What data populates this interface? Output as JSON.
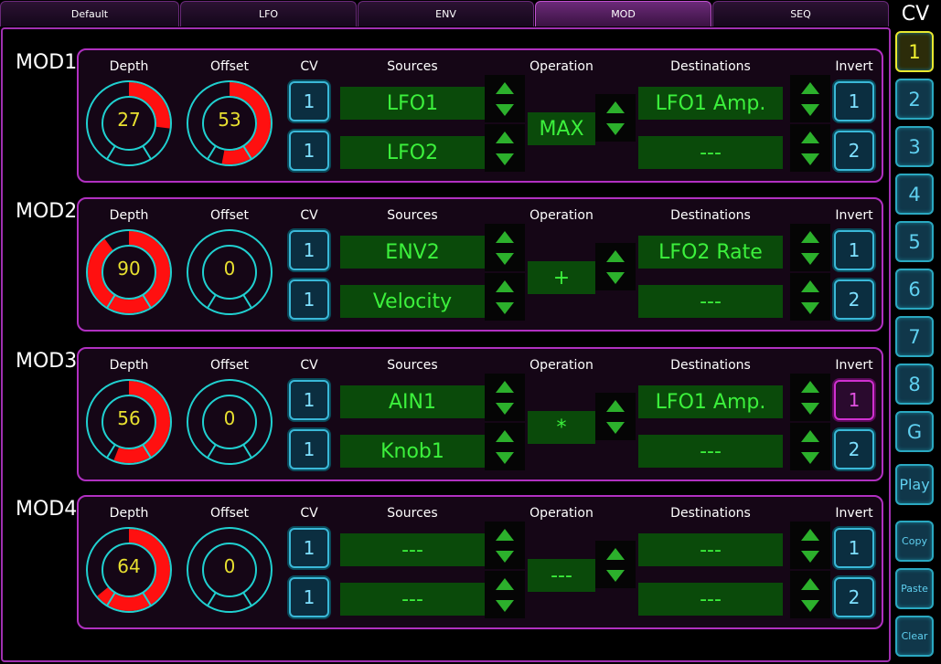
{
  "tabs": [
    {
      "label": "Default"
    },
    {
      "label": "LFO"
    },
    {
      "label": "ENV"
    },
    {
      "label": "MOD"
    },
    {
      "label": "SEQ"
    }
  ],
  "sidebar": {
    "title": "CV",
    "buttons": [
      "1",
      "2",
      "3",
      "4",
      "5",
      "6",
      "7",
      "8",
      "G",
      "Play",
      "Copy",
      "Paste",
      "Clear"
    ]
  },
  "headers": {
    "depth": "Depth",
    "offset": "Offset",
    "cv": "CV",
    "sources": "Sources",
    "operation": "Operation",
    "destinations": "Destinations",
    "invert": "Invert"
  },
  "mods": [
    {
      "label": "MOD1",
      "depth": "27",
      "offset": "53",
      "cv": [
        "1",
        "1"
      ],
      "sources": [
        "LFO1",
        "LFO2"
      ],
      "operation": "MAX",
      "destinations": [
        "LFO1 Amp.",
        "---"
      ],
      "invert": [
        "1",
        "2"
      ],
      "invert_on": [
        false,
        false
      ]
    },
    {
      "label": "MOD2",
      "depth": "90",
      "offset": "0",
      "cv": [
        "1",
        "1"
      ],
      "sources": [
        "ENV2",
        "Velocity"
      ],
      "operation": "+",
      "destinations": [
        "LFO2 Rate",
        "---"
      ],
      "invert": [
        "1",
        "2"
      ],
      "invert_on": [
        false,
        false
      ]
    },
    {
      "label": "MOD3",
      "depth": "56",
      "offset": "0",
      "cv": [
        "1",
        "1"
      ],
      "sources": [
        "AIN1",
        "Knob1"
      ],
      "operation": "*",
      "destinations": [
        "LFO1 Amp.",
        "---"
      ],
      "invert": [
        "1",
        "2"
      ],
      "invert_on": [
        true,
        false
      ]
    },
    {
      "label": "MOD4",
      "depth": "64",
      "offset": "0",
      "cv": [
        "1",
        "1"
      ],
      "sources": [
        "---",
        "---"
      ],
      "operation": "---",
      "destinations": [
        "---",
        "---"
      ],
      "invert": [
        "1",
        "2"
      ],
      "invert_on": [
        false,
        false
      ]
    }
  ],
  "colors": {
    "accent_purple": "#b030c0",
    "knob_ring": "#20d0d0",
    "knob_fill": "#ff1010",
    "value_yellow": "#e8e030",
    "field_green": "#3cf03c",
    "button_cyan": "#3ab8d8",
    "selected_yellow": "#e8e830"
  }
}
